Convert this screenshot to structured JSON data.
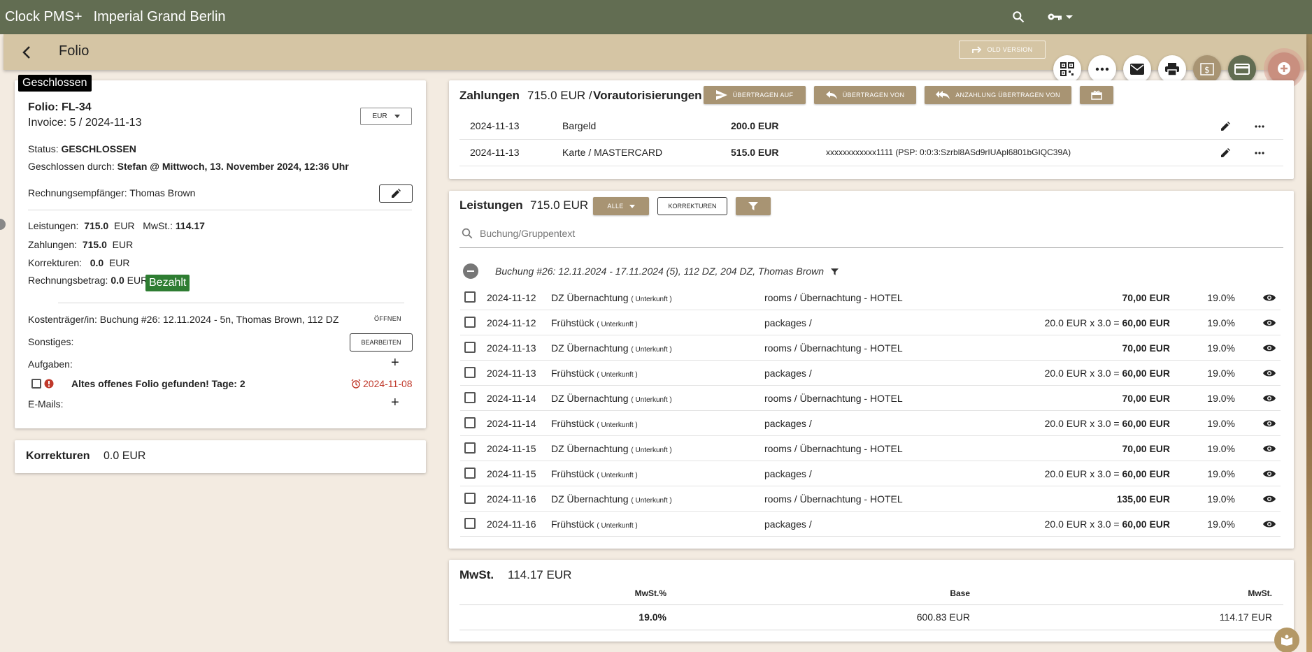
{
  "topbar": {
    "brand": "Clock PMS+",
    "hotel": "Imperial Grand Berlin"
  },
  "subbar": {
    "title": "Folio",
    "old_version": "OLD VERSION"
  },
  "folio": {
    "status_badge": "Geschlossen",
    "number": "Folio: FL-34",
    "invoice": "Invoice: 5 / 2024-11-13",
    "currency": "EUR",
    "status_label": "Status:",
    "status_value": "GESCHLOSSEN",
    "closed_by_label": "Geschlossen durch:",
    "closed_by_value": "Stefan @ Mittwoch, 13. November 2024, 12:36 Uhr",
    "recipient_label": "Rechnungsempfänger:",
    "recipient_value": "Thomas Brown",
    "leistungen_label": "Leistungen:",
    "leistungen_value": "715.0",
    "eur": "EUR",
    "mwst_label": "MwSt.:",
    "mwst_value": "114.17",
    "zahlungen_label": "Zahlungen:",
    "zahlungen_value": "715.0",
    "korrekturen_label": "Korrekturen:",
    "korrekturen_value": "0.0",
    "betrag_label": "Rechnungsbetrag:",
    "betrag_value": "0.0",
    "paid_badge": "Bezahlt",
    "cost_label": "Kostenträger/in:",
    "cost_value": "Buchung #26: 12.11.2024 - 5n, Thomas Brown, 112 DZ",
    "open_btn": "ÖFFNEN",
    "misc_label": "Sonstiges:",
    "edit_btn": "BEARBEITEN",
    "tasks_label": "Aufgaben:",
    "task_text": "Altes offenes Folio gefunden! Tage: 2",
    "task_date": "2024-11-08",
    "emails_label": "E-Mails:",
    "plus": "+"
  },
  "korrekturen_card": {
    "title": "Korrekturen",
    "amount": "0.0 EUR"
  },
  "payments": {
    "title": "Zahlungen",
    "amount": "715.0 EUR /",
    "preauth": "Vorautorisierungen",
    "btn_to": "ÜBERTRAGEN AUF",
    "btn_from": "ÜBERTRAGEN VON",
    "btn_deposit": "ANZAHLUNG ÜBERTRAGEN VON",
    "rows": [
      {
        "date": "2024-11-13",
        "type": "Bargeld",
        "amount": "200.0 EUR",
        "ref": ""
      },
      {
        "date": "2024-11-13",
        "type": "Karte / MASTERCARD",
        "amount": "515.0 EUR",
        "ref": "xxxxxxxxxxxx1111 (PSP: 0:0:3:Szrbl8ASd9rIUApl6801bGIQC39A)"
      }
    ]
  },
  "charges": {
    "title": "Leistungen",
    "amount": "715.0 EUR",
    "filter_all": "ALLE",
    "btn_corrections": "KORREKTUREN",
    "search_placeholder": "Buchung/Gruppentext",
    "group": "Buchung #26: 12.11.2024 - 17.11.2024 (5), 112 DZ, 204 DZ, Thomas Brown",
    "rows": [
      {
        "date": "2024-11-12",
        "name": "DZ Übernachtung",
        "tag": "( Unterkunft )",
        "account": "rooms / Übernachtung - HOTEL",
        "calc": "",
        "price": "70,00 EUR",
        "vat": "19.0%"
      },
      {
        "date": "2024-11-12",
        "name": "Frühstück",
        "tag": "( Unterkunft )",
        "account": "packages /",
        "calc": "20.0 EUR x 3.0 =",
        "price": "60,00 EUR",
        "vat": "19.0%"
      },
      {
        "date": "2024-11-13",
        "name": "DZ Übernachtung",
        "tag": "( Unterkunft )",
        "account": "rooms / Übernachtung - HOTEL",
        "calc": "",
        "price": "70,00 EUR",
        "vat": "19.0%"
      },
      {
        "date": "2024-11-13",
        "name": "Frühstück",
        "tag": "( Unterkunft )",
        "account": "packages /",
        "calc": "20.0 EUR x 3.0 =",
        "price": "60,00 EUR",
        "vat": "19.0%"
      },
      {
        "date": "2024-11-14",
        "name": "DZ Übernachtung",
        "tag": "( Unterkunft )",
        "account": "rooms / Übernachtung - HOTEL",
        "calc": "",
        "price": "70,00 EUR",
        "vat": "19.0%"
      },
      {
        "date": "2024-11-14",
        "name": "Frühstück",
        "tag": "( Unterkunft )",
        "account": "packages /",
        "calc": "20.0 EUR x 3.0 =",
        "price": "60,00 EUR",
        "vat": "19.0%"
      },
      {
        "date": "2024-11-15",
        "name": "DZ Übernachtung",
        "tag": "( Unterkunft )",
        "account": "rooms / Übernachtung - HOTEL",
        "calc": "",
        "price": "70,00 EUR",
        "vat": "19.0%"
      },
      {
        "date": "2024-11-15",
        "name": "Frühstück",
        "tag": "( Unterkunft )",
        "account": "packages /",
        "calc": "20.0 EUR x 3.0 =",
        "price": "60,00 EUR",
        "vat": "19.0%"
      },
      {
        "date": "2024-11-16",
        "name": "DZ Übernachtung",
        "tag": "( Unterkunft )",
        "account": "rooms / Übernachtung - HOTEL",
        "calc": "",
        "price": "135,00 EUR",
        "vat": "19.0%"
      },
      {
        "date": "2024-11-16",
        "name": "Frühstück",
        "tag": "( Unterkunft )",
        "account": "packages /",
        "calc": "20.0 EUR x 3.0 =",
        "price": "60,00 EUR",
        "vat": "19.0%"
      }
    ]
  },
  "vat": {
    "title": "MwSt.",
    "amount": "114.17 EUR",
    "col_rate": "MwSt.%",
    "col_base": "Base",
    "col_vat": "MwSt.",
    "rate": "19.0%",
    "base": "600.83 EUR",
    "value": "114.17 EUR"
  },
  "colors": {
    "topbar": "#626d52",
    "subbar": "#d5c5a4",
    "tan_button": "#a89473",
    "paid": "#2e7d32",
    "background": "#f3ebe1"
  }
}
